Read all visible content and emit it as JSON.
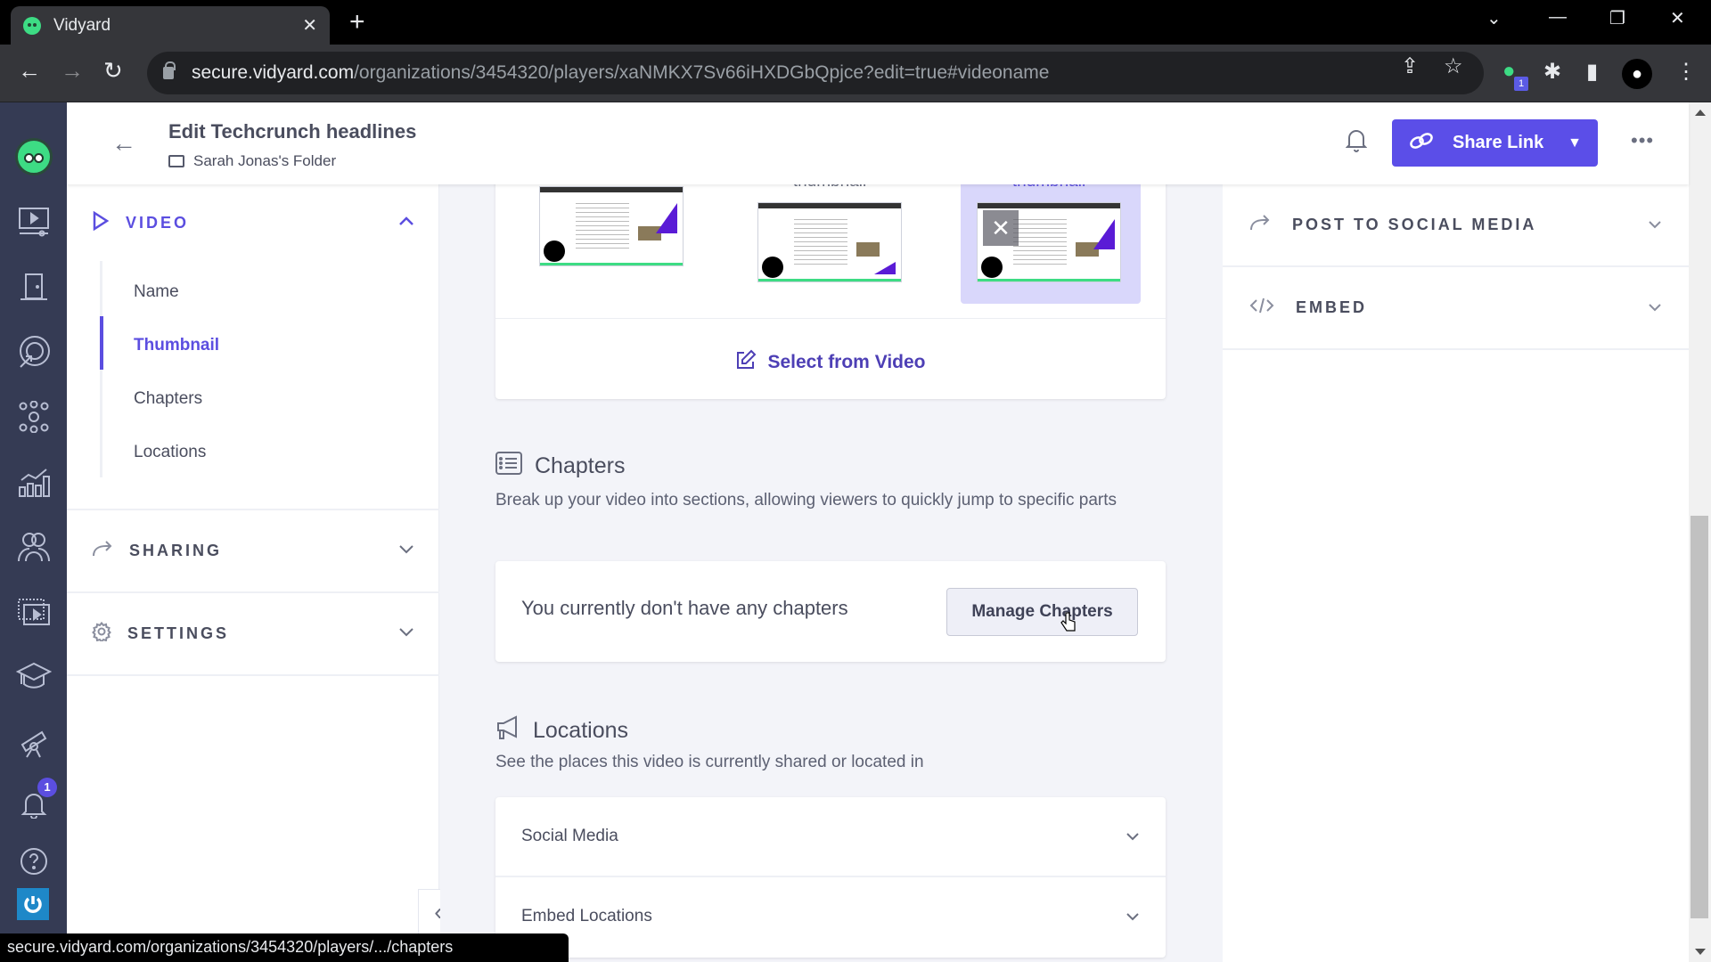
{
  "browser": {
    "tab_title": "Vidyard",
    "url_host": "secure.vidyard.com",
    "url_path": "/organizations/3454320/players/xaNMKX7Sv66iHXDGbQpjce?edit=true#videoname",
    "extension_badge": "1",
    "status_url": "secure.vidyard.com/organizations/3454320/players/.../chapters"
  },
  "rail": {
    "items": [
      "logo-icon",
      "videos-icon",
      "door-icon",
      "target-icon",
      "integrations-icon",
      "analytics-icon",
      "audience-icon",
      "playlist-icon",
      "learning-icon",
      "explore-icon",
      "notifications-icon",
      "help-icon",
      "power-icon"
    ],
    "notification_count": "1"
  },
  "header": {
    "title": "Edit Techcrunch headlines",
    "folder": "Sarah Jonas's Folder",
    "share_label": "Share Link",
    "more_label": "•••"
  },
  "leftnav": {
    "video_label": "VIDEO",
    "sub_items": [
      {
        "label": "Name",
        "active": false
      },
      {
        "label": "Thumbnail",
        "active": true
      },
      {
        "label": "Chapters",
        "active": false
      },
      {
        "label": "Locations",
        "active": false
      }
    ],
    "sharing_label": "SHARING",
    "settings_label": "SETTINGS",
    "collapse_label": "«"
  },
  "thumbnail": {
    "options": [
      {
        "label": "",
        "selected": false
      },
      {
        "label": "thumbnail",
        "selected": false
      },
      {
        "label": "thumbnail",
        "selected": true
      }
    ],
    "select_from_video": "Select from Video"
  },
  "chapters": {
    "title": "Chapters",
    "description": "Break up your video into sections, allowing viewers to quickly jump to specific parts",
    "empty_text": "You currently don't have any chapters",
    "manage_button": "Manage Chapters"
  },
  "locations": {
    "title": "Locations",
    "description": "See the places this video is currently shared or located in",
    "rows": [
      "Social Media",
      "Embed Locations"
    ]
  },
  "rightpanel": {
    "post_social": "POST TO SOCIAL MEDIA",
    "embed": "EMBED"
  },
  "colors": {
    "accent": "#5b4ee8",
    "rail_bg": "#353b54",
    "selected_thumb_bg": "#d9d7fb"
  }
}
